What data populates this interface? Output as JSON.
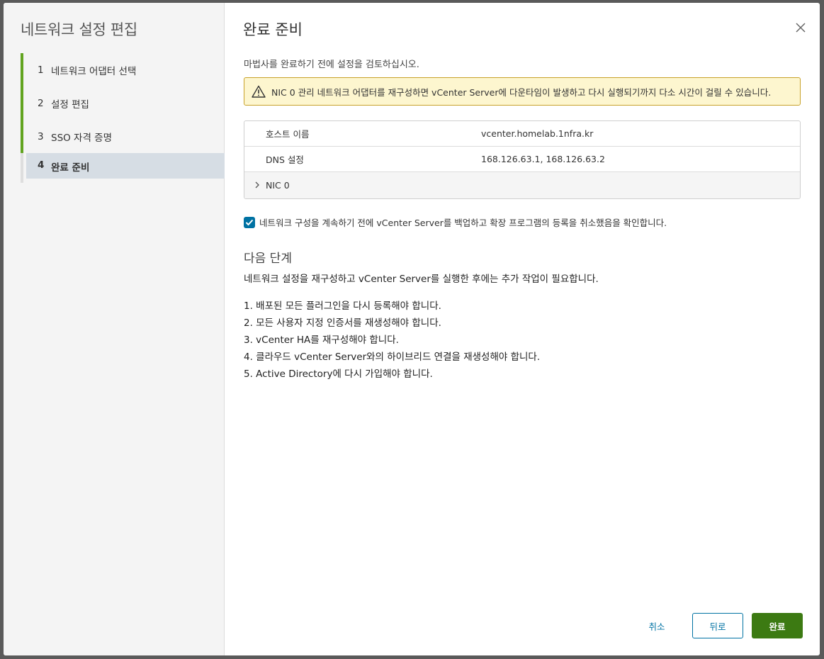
{
  "wizard": {
    "title": "네트워크 설정 편집"
  },
  "steps": [
    {
      "num": "1",
      "label": "네트워크 어댑터 선택"
    },
    {
      "num": "2",
      "label": "설정 편집"
    },
    {
      "num": "3",
      "label": "SSO 자격 증명"
    },
    {
      "num": "4",
      "label": "완료 준비"
    }
  ],
  "page": {
    "title": "완료 준비",
    "subtitle": "마법사를 완료하기 전에 설정을 검토하십시오."
  },
  "alert": {
    "text": "NIC 0 관리 네트워크 어댑터를 재구성하면 vCenter Server에 다운타임이 발생하고 다시 실행되기까지 다소 시간이 걸릴 수 있습니다.",
    "color": "#c8a22b"
  },
  "summary": {
    "rows": [
      {
        "key": "호스트 이름",
        "value": "vcenter.homelab.1nfra.kr"
      },
      {
        "key": "DNS 설정",
        "value": "168.126.63.1, 168.126.63.2"
      }
    ],
    "nic_label": "NIC 0"
  },
  "confirm": {
    "checked": true,
    "label": "네트워크 구성을 계속하기 전에 vCenter Server를 백업하고 확장 프로그램의 등록을 취소했음을 확인합니다."
  },
  "next_steps": {
    "title": "다음 단계",
    "description": "네트워크 설정을 재구성하고 vCenter Server를 실행한 후에는 추가 작업이 필요합니다.",
    "items": [
      "1. 배포된 모든 플러그인을 다시 등록해야 합니다.",
      "2. 모든 사용자 지정 인증서를 재생성해야 합니다.",
      "3. vCenter HA를 재구성해야 합니다.",
      "4. 클라우드 vCenter Server와의 하이브리드 연결을 재생성해야 합니다.",
      "5. Active Directory에 다시 가입해야 합니다."
    ]
  },
  "footer": {
    "cancel_label": "취소",
    "back_label": "뒤로",
    "finish_label": "완료"
  },
  "colors": {
    "accent": "#0072a3",
    "step_done": "#62a420",
    "finish": "#3c7a12"
  }
}
